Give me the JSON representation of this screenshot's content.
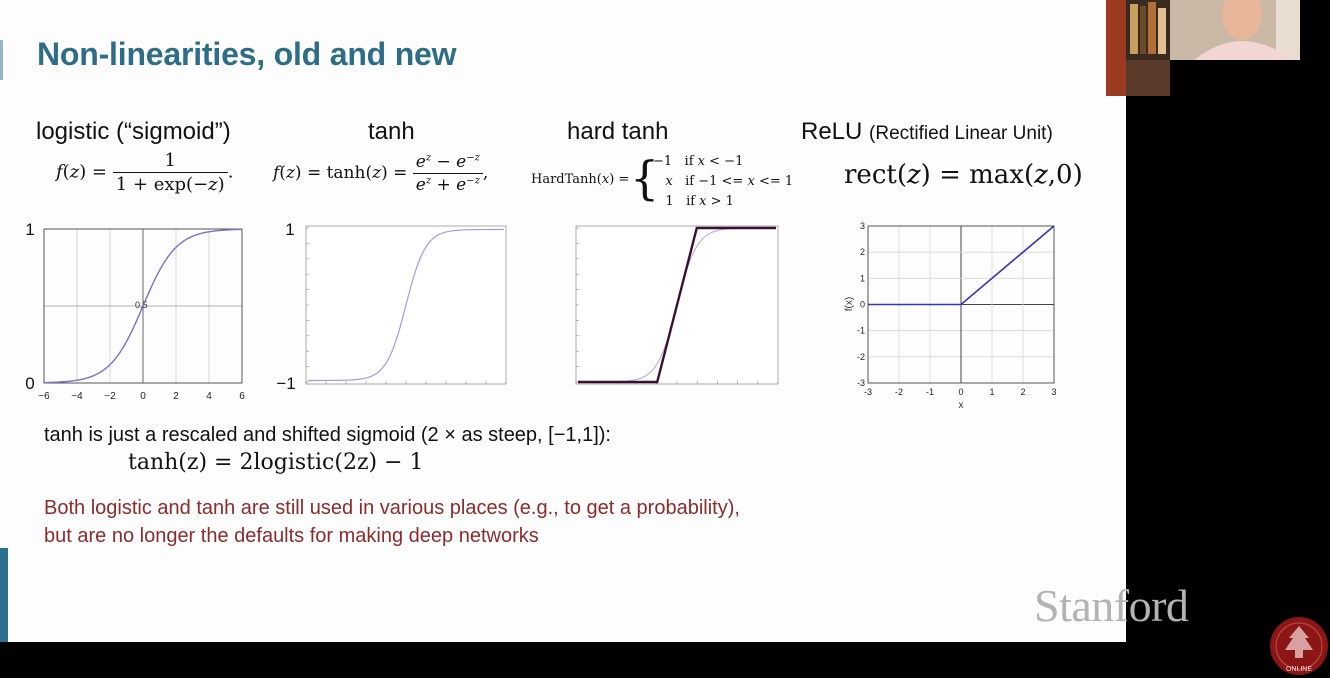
{
  "slide": {
    "title": "Non-linearities, old and new",
    "headings": {
      "logistic": "logistic (“sigmoid”)",
      "tanh": "tanh",
      "hard_tanh": "hard tanh",
      "relu": "ReLU",
      "relu_paren": "(Rectified Linear Unit)"
    },
    "tanh_identity_intro": "tanh is just a rescaled and shifted sigmoid (2 × as steep, [−1,1]):",
    "tanh_identity": "tanh(z) = 2logistic(2z) − 1",
    "note": "Both logistic and tanh are still used in various places (e.g., to get a probability), but are no longer the defaults for making deep networks",
    "brand": "Stanford",
    "seal_text": "ONLINE"
  },
  "plot_labels": {
    "logistic_y_top": "1",
    "logistic_y_bottom": "0",
    "logistic_y_mid": "0.5",
    "logistic_x_ticks": [
      "−6",
      "−4",
      "−2",
      "0",
      "2",
      "4",
      "6"
    ],
    "tanh_y_top": "1",
    "tanh_y_bottom": "−1",
    "relu_y_label": "f(x)",
    "relu_x_label": "x",
    "relu_x_ticks": [
      "-3",
      "-2",
      "-1",
      "0",
      "1",
      "2",
      "3"
    ],
    "relu_y_ticks": [
      "3",
      "2",
      "1",
      "0",
      "-1",
      "-2",
      "-3"
    ]
  },
  "colors": {
    "title": "#2e6d87",
    "note": "#8c2b2b",
    "curve": "#7474c8",
    "relu_line": "#3333bb",
    "hard_tanh_line": "#3a1030"
  },
  "chart_data": [
    {
      "type": "line",
      "id": "logistic",
      "series": [
        {
          "function": "1/(1+exp(-z))"
        }
      ],
      "x_ticks": [
        -6,
        -4,
        -2,
        0,
        2,
        4,
        6
      ],
      "xlim": [
        -6,
        6
      ],
      "ylim": [
        0,
        1
      ],
      "grid": true
    },
    {
      "type": "line",
      "id": "tanh",
      "series": [
        {
          "function": "tanh(z)"
        }
      ],
      "xlim": [
        -5,
        5
      ],
      "ylim": [
        -1,
        1
      ],
      "grid": false
    },
    {
      "type": "line",
      "id": "hard_tanh",
      "series": [
        {
          "x": [
            -5,
            -1,
            1,
            5
          ],
          "y": [
            -1,
            -1,
            1,
            1
          ]
        },
        {
          "function": "tanh(z)"
        }
      ],
      "xlim": [
        -5,
        5
      ],
      "ylim": [
        -1,
        1
      ]
    },
    {
      "type": "line",
      "id": "relu",
      "series": [
        {
          "x": [
            -3,
            0,
            3
          ],
          "y": [
            0,
            0,
            3
          ]
        }
      ],
      "xlim": [
        -3,
        3
      ],
      "ylim": [
        -3,
        3
      ],
      "x_ticks": [
        -3,
        -2,
        -1,
        0,
        1,
        2,
        3
      ],
      "y_ticks": [
        -3,
        -2,
        -1,
        0,
        1,
        2,
        3
      ],
      "grid": true
    }
  ]
}
